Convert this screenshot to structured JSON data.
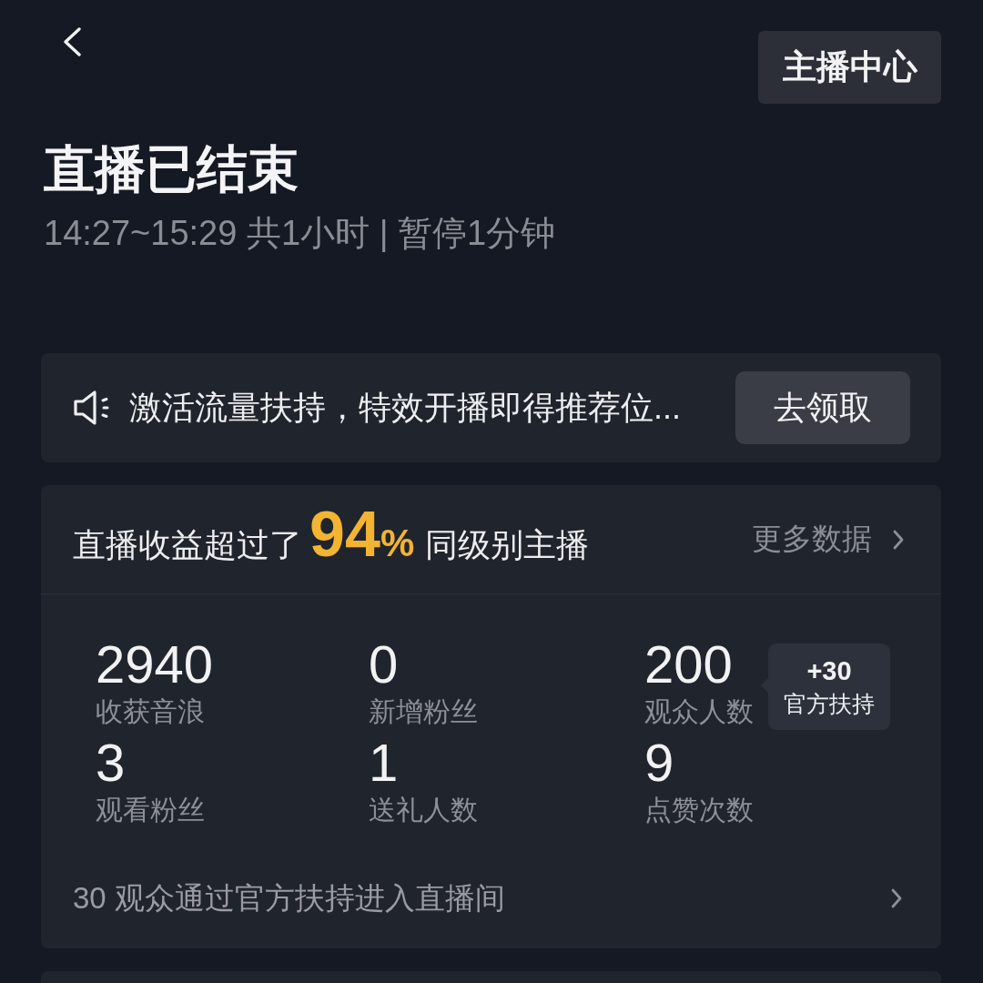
{
  "header": {
    "action_button": "主播中心"
  },
  "status": {
    "title": "直播已结束",
    "summary": "14:27~15:29 共1小时 | 暂停1分钟"
  },
  "promo": {
    "text": "激活流量扶持，特效开播即得推荐位...",
    "button": "去领取"
  },
  "earnings": {
    "before": "直播收益超过了",
    "percent": "94",
    "unit": "%",
    "after": "同级别主播",
    "more_link": "更多数据"
  },
  "stats": [
    {
      "value": "2940",
      "label": "收获音浪"
    },
    {
      "value": "0",
      "label": "新增粉丝"
    },
    {
      "value": "200",
      "label": "观众人数",
      "badge": {
        "value": "+30",
        "label": "官方扶持"
      }
    },
    {
      "value": "3",
      "label": "观看粉丝"
    },
    {
      "value": "1",
      "label": "送礼人数"
    },
    {
      "value": "9",
      "label": "点赞次数"
    }
  ],
  "support_link": {
    "text": "30 观众通过官方扶持进入直播间"
  }
}
